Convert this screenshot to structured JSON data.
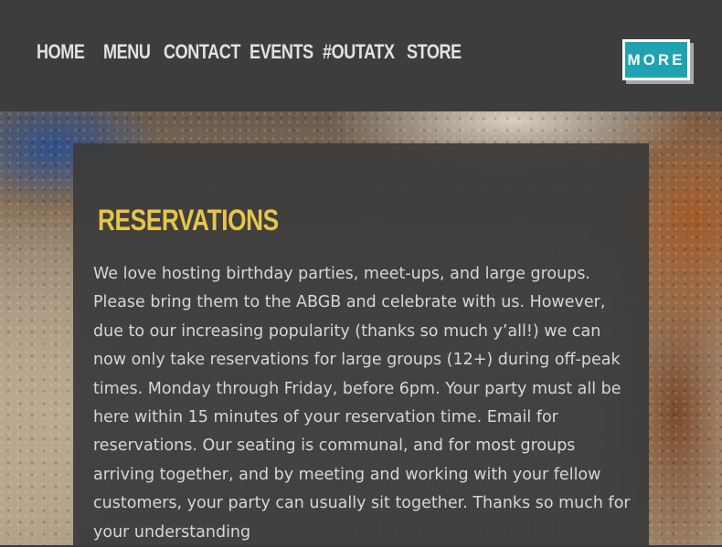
{
  "nav": {
    "items": [
      "HOME",
      "MENU",
      "CONTACT",
      "EVENTS",
      "#OUTATX",
      "STORE"
    ],
    "more_label": "MORE"
  },
  "colors": {
    "header_bg": "#3d3d3d",
    "accent_teal": "#1fa3b0",
    "title_yellow": "#e6c64a",
    "body_text": "#d6d6d6"
  },
  "reservations": {
    "title": "RESERVATIONS",
    "body": "We love hosting birthday parties, meet-ups, and large groups. Please bring them to the ABGB and celebrate with us. However, due to our increasing popularity (thanks so much y’all!) we can now only take reservations for large groups (12+) during off-peak times. Monday through Friday, before 6pm. Your party must all be here within 15 minutes of your reservation time. Email for reservations. Our seating is communal, and for most groups arriving together, and by meeting and working with your fellow customers, your party can usually sit together. Thanks so much for your understanding"
  }
}
